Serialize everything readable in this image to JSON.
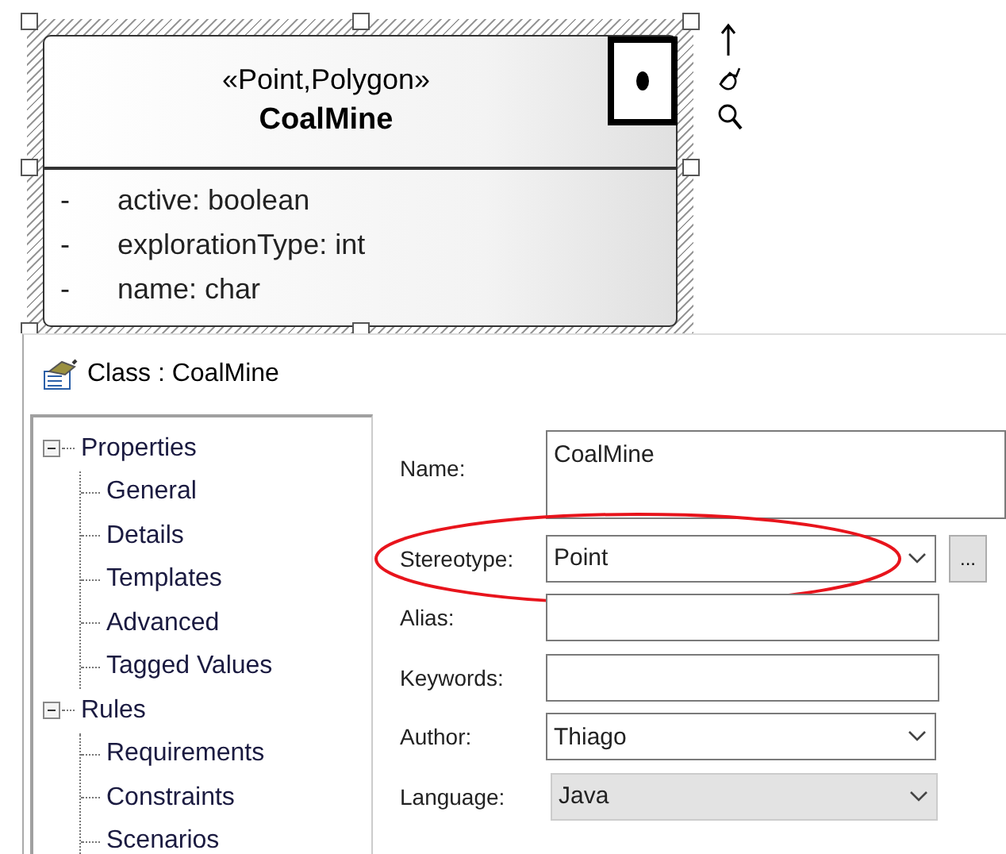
{
  "diagram": {
    "class": {
      "stereotype": "«Point,Polygon»",
      "name": "CoalMine",
      "selected": true,
      "attributes": [
        {
          "visibility": "-",
          "text": "active: boolean"
        },
        {
          "visibility": "-",
          "text": "explorationType: int"
        },
        {
          "visibility": "-",
          "text": "name: char"
        }
      ]
    }
  },
  "dialog": {
    "title": "Class : CoalMine",
    "tree": [
      {
        "label": "Properties",
        "expanded": true,
        "children": [
          {
            "label": "General"
          },
          {
            "label": "Details"
          },
          {
            "label": "Templates"
          },
          {
            "label": "Advanced"
          },
          {
            "label": "Tagged Values"
          }
        ]
      },
      {
        "label": "Rules",
        "expanded": true,
        "children": [
          {
            "label": "Requirements"
          },
          {
            "label": "Constraints"
          },
          {
            "label": "Scenarios"
          }
        ]
      }
    ],
    "fields": [
      {
        "kind": "textarea",
        "label": "Name:",
        "value": "CoalMine"
      },
      {
        "kind": "combo",
        "label": "Stereotype:",
        "value": "Point",
        "button": "...",
        "highlighted": true
      },
      {
        "kind": "text",
        "label": "Alias:"
      },
      {
        "kind": "text",
        "label": "Keywords:"
      },
      {
        "kind": "combo",
        "label": "Author:",
        "value": "Thiago"
      },
      {
        "kind": "dropdown",
        "label": "Language:",
        "value": "Java"
      }
    ]
  }
}
